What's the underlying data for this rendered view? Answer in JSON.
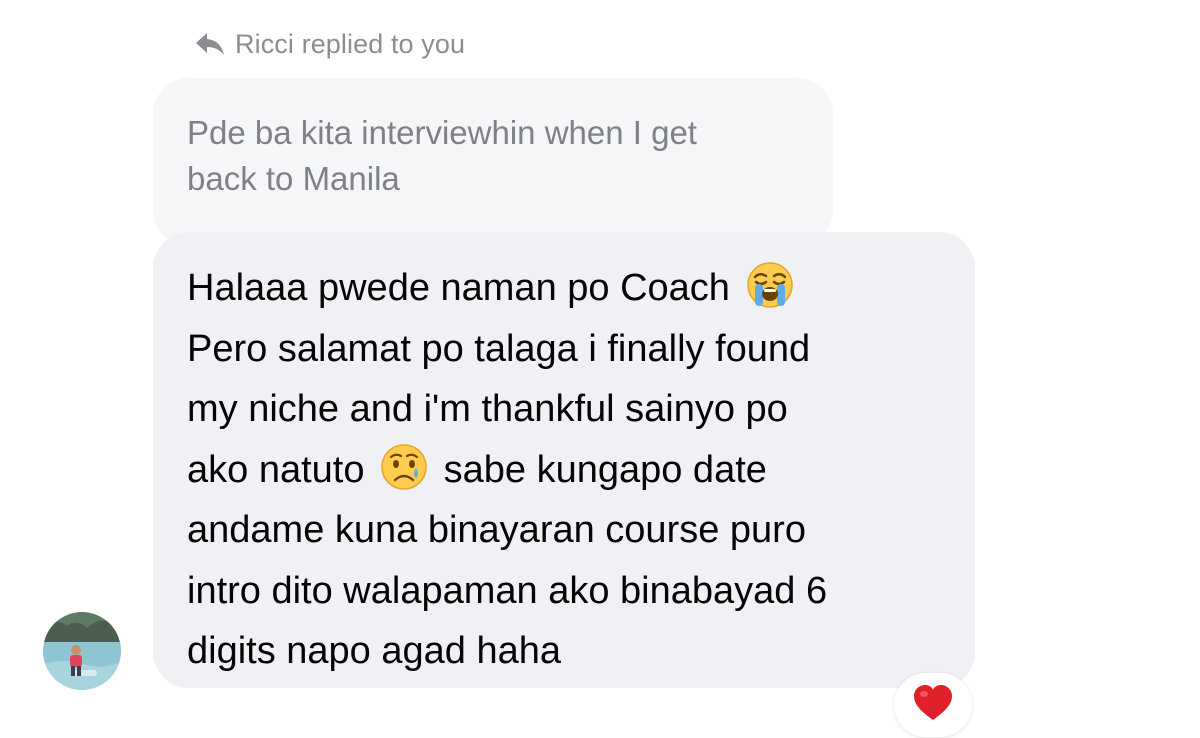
{
  "reply_header": {
    "text": "Ricci replied to you",
    "icon": "reply-arrow-icon"
  },
  "quoted_message": {
    "lines": [
      "Pde ba kita interviewhin when I get",
      "back to Manila"
    ]
  },
  "message": {
    "lines": [
      {
        "text": "Halaaa pwede naman po Coach",
        "emoji_after": "loudly-crying-face-emoji"
      },
      {
        "text": "Pero salamat po talaga i finally found"
      },
      {
        "text": "my niche and i'm thankful sainyo po"
      },
      {
        "text": "ako natuto",
        "emoji_after": "crying-face-emoji",
        "text_after": "sabe kungapo date"
      },
      {
        "text": "andame kuna binayaran course puro"
      },
      {
        "text": "intro dito walapaman ako binabayad 6"
      },
      {
        "text": "digits napo agad haha"
      }
    ]
  },
  "avatar": {
    "icon": "user-avatar"
  },
  "reaction": {
    "icon": "red-heart-emoji"
  },
  "colors": {
    "quoted_bubble_bg": "#f5f6f8",
    "message_bubble_bg": "#eff1f4",
    "muted_text": "#8a8d91",
    "heart": "#e0202a"
  }
}
